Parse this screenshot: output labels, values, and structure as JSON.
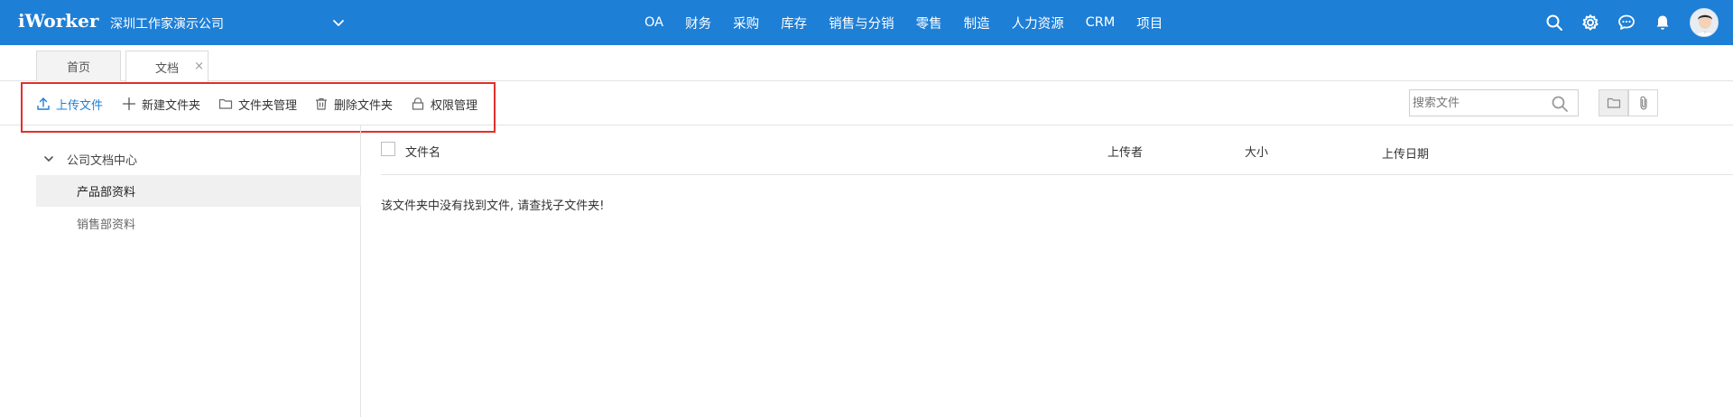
{
  "header": {
    "brand": "iWorker",
    "company": "深圳工作家演示公司",
    "nav": [
      "OA",
      "财务",
      "采购",
      "库存",
      "销售与分销",
      "零售",
      "制造",
      "人力资源",
      "CRM",
      "项目"
    ],
    "icons": [
      "search-icon",
      "gear-icon",
      "chat-icon",
      "bell-icon"
    ],
    "brand_color": "#1e7fd6"
  },
  "tabs": [
    {
      "label": "首页",
      "active": false
    },
    {
      "label": "文档",
      "active": true,
      "closable": true
    }
  ],
  "toolbar": {
    "upload": "上传文件",
    "new_folder": "新建文件夹",
    "folder_mgmt": "文件夹管理",
    "delete_folder": "删除文件夹",
    "permission": "权限管理",
    "highlight_color": "#e0302b"
  },
  "search": {
    "placeholder": "搜索文件",
    "value": ""
  },
  "tree": {
    "root": "公司文档中心",
    "items": [
      {
        "label": "产品部资料",
        "selected": true
      },
      {
        "label": "销售部资料",
        "selected": false
      }
    ]
  },
  "table": {
    "columns": [
      "文件名",
      "上传者",
      "大小",
      "上传日期"
    ],
    "empty_message": "该文件夹中没有找到文件, 请查找子文件夹!"
  }
}
